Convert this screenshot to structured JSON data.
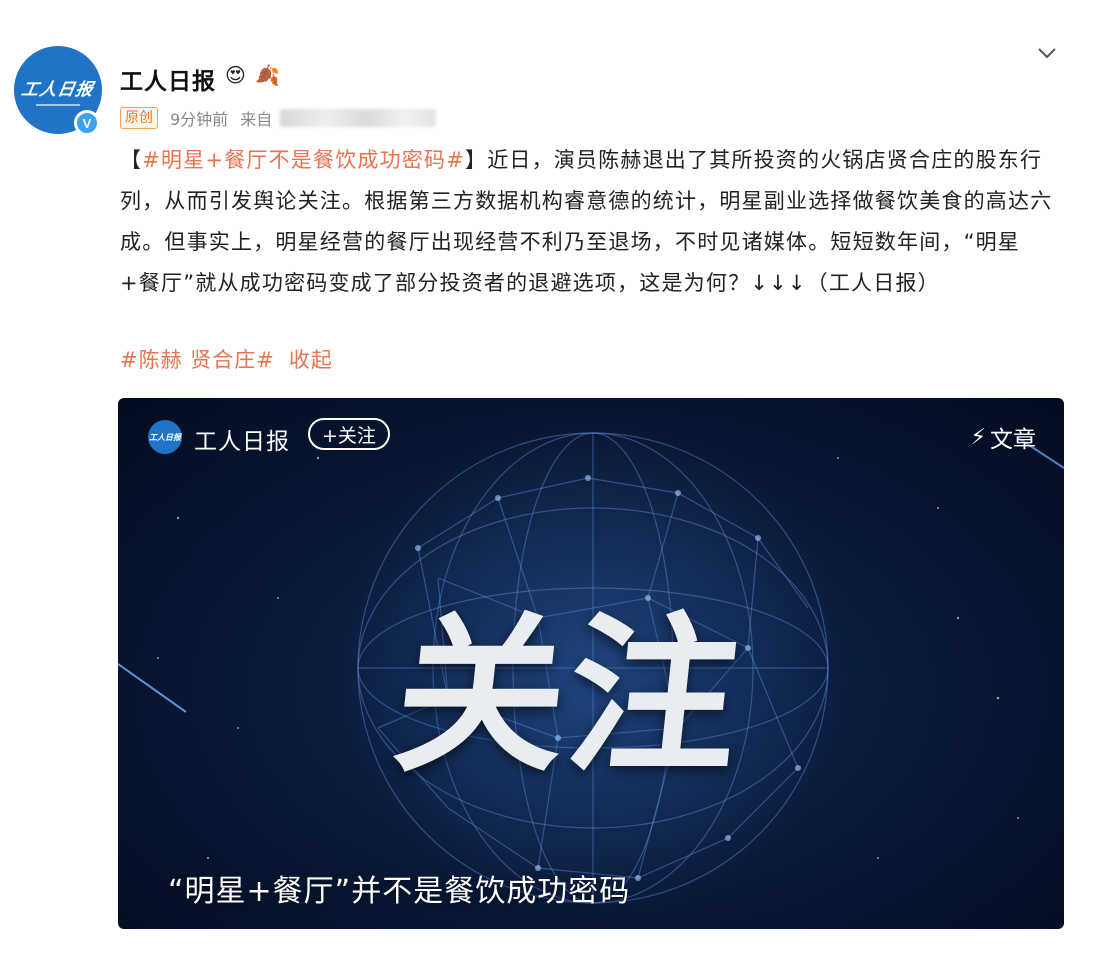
{
  "author": {
    "name": "工人日报",
    "avatar_text": "工人日报",
    "verified_mark": "V",
    "badges": [
      "😍",
      "🍂"
    ]
  },
  "meta": {
    "original_tag": "原创",
    "time": "9分钟前",
    "from": "来自"
  },
  "post": {
    "open_bracket": "【",
    "hashtag": "#明星+餐厅不是餐饮成功密码#",
    "body": "】近日，演员陈赫退出了其所投资的火锅店贤合庄的股东行列，从而引发舆论关注。根据第三方数据机构睿意德的统计，明星副业选择做餐饮美食的高达六成。但事实上，明星经营的餐厅出现经营不利乃至退场，不时见诸媒体。短短数年间，“明星+餐厅”就从成功密码变成了部分投资者的退避选项，这是为何？↓↓↓（工人日报）",
    "tags": "#陈赫 贤合庄#",
    "collapse": "收起"
  },
  "video": {
    "channel_name": "工人日报",
    "avatar_text": "工人日报",
    "follow": "+关注",
    "article": "文章",
    "big_text": "关注",
    "caption": "“明星+餐厅”并不是餐饮成功密码"
  },
  "colors": {
    "link": "#eb7350",
    "brand_blue": "#1f74c8",
    "video_bg": "#0a1a3a"
  },
  "icons": [
    "chevron-down-icon",
    "verified-icon",
    "lightning-icon"
  ]
}
